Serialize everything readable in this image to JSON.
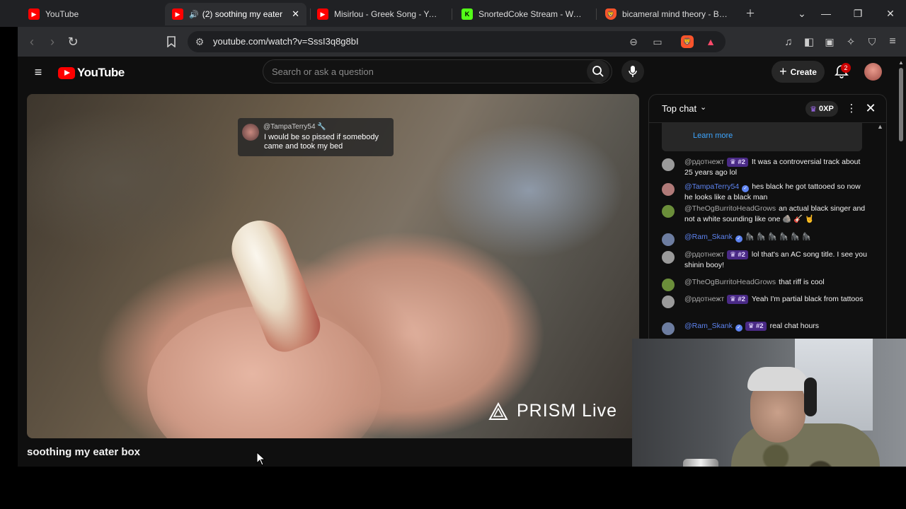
{
  "browser": {
    "tabs": [
      {
        "title": "YouTube",
        "icon": "youtube-favicon"
      },
      {
        "title": "(2) soothing my eater",
        "icon": "youtube-favicon",
        "audio": "🔊"
      },
      {
        "title": "Misirlou - Greek Song - YouTu",
        "icon": "youtube-favicon"
      },
      {
        "title": "SnortedCoke Stream - Watch",
        "icon": "kick-favicon"
      },
      {
        "title": "bicameral mind theory - Brav",
        "icon": "brave-favicon"
      }
    ],
    "url": "youtube.com/watch?v=SssI3q8g8bI",
    "shields_count": "16"
  },
  "youtube": {
    "logo_text": "YouTube",
    "search_placeholder": "Search or ask a question",
    "create_label": "Create",
    "notification_count": "2",
    "video_title": "soothing my eater box",
    "video_overlay": {
      "user": "@TampaTerry54 🔧",
      "message": "I would be so pissed if somebody came and took my bed"
    },
    "watermark": "PRISM Live"
  },
  "chat": {
    "mode": "Top chat",
    "xp": "0XP",
    "learn_more": "Learn more",
    "messages": [
      {
        "user": "@рдотнежт",
        "rank": "#2",
        "text": "It was a controversial track about 25 years ago lol",
        "avatar_color": "#9a9a9a"
      },
      {
        "user": "@TampaTerry54",
        "verified": true,
        "text": "hes black he got tattooed so now he looks like a black man",
        "avatar_color": "#b07a78",
        "blue": true
      },
      {
        "user": "@TheOgBurritoHeadGrows",
        "text": "an actual black singer and not a white sounding like one 🪨 🎸 🤘",
        "avatar_color": "#6b8e3a"
      },
      {
        "user": "@Ram_Skank",
        "verified": true,
        "text": "🦍 🦍 🦍 🦍 🦍 🦍",
        "avatar_color": "#6d7da0",
        "blue": true
      },
      {
        "user": "@рдотнежт",
        "rank": "#2",
        "text": "lol that's an AC song title. I see you shinin booy!",
        "avatar_color": "#9a9a9a"
      },
      {
        "user": "@TheOgBurritoHeadGrows",
        "text": "that riff is cool",
        "avatar_color": "#6b8e3a"
      },
      {
        "user": "@рдотнежт",
        "rank": "#2",
        "text": "Yeah I'm partial black from tattoos",
        "avatar_color": "#9a9a9a"
      },
      {
        "user": "@Ram_Skank",
        "verified": true,
        "rank": "#2",
        "text": "real chat hours",
        "avatar_color": "#6d7da0",
        "blue": true
      }
    ]
  }
}
